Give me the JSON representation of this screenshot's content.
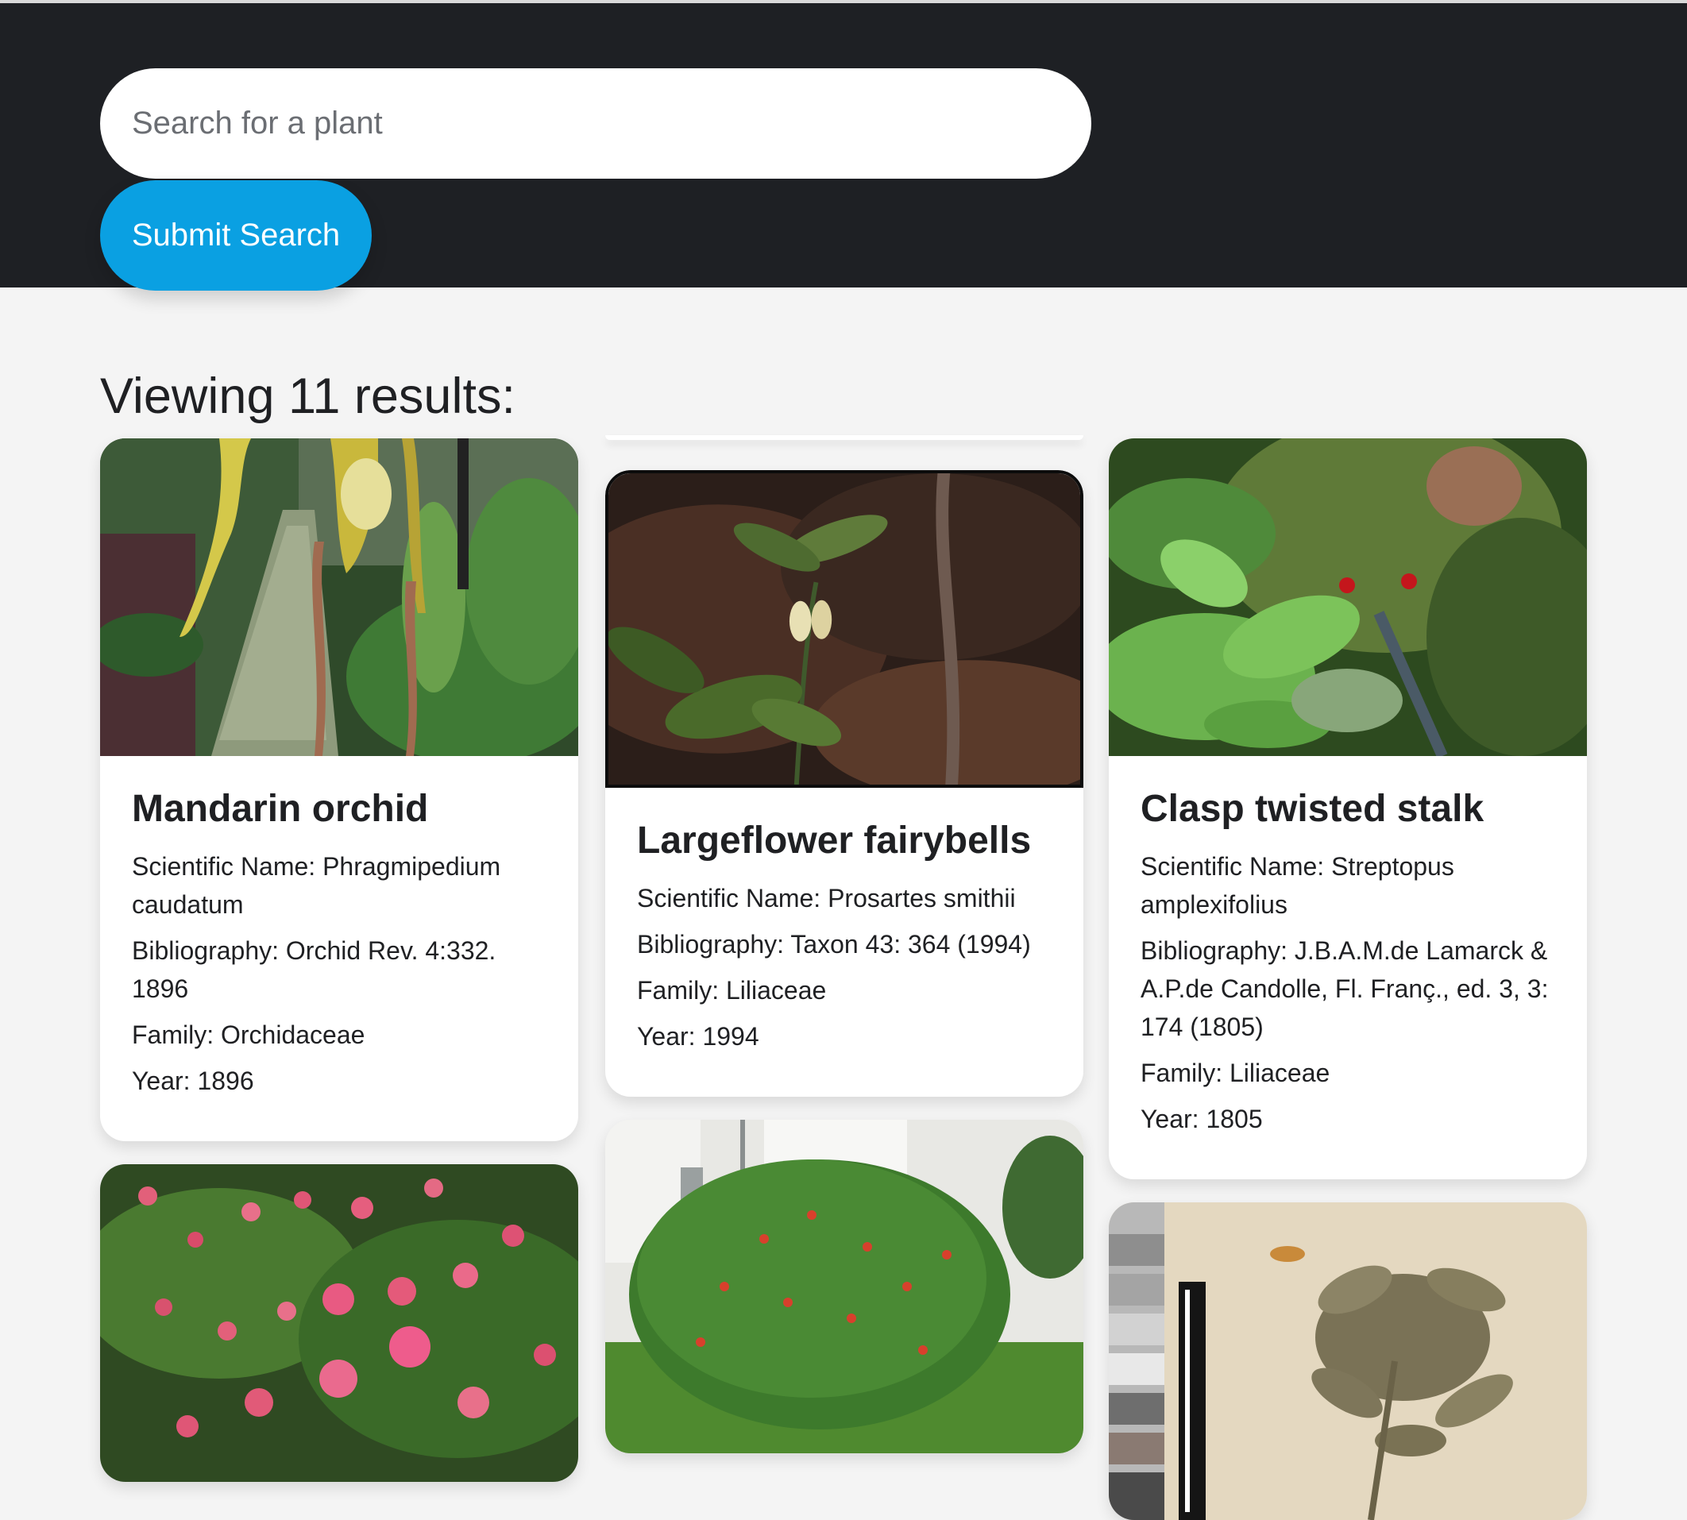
{
  "search": {
    "placeholder": "Search for a plant",
    "value": "",
    "submit_label": "Submit Search"
  },
  "results": {
    "heading": "Viewing 11 results:",
    "count": 11
  },
  "cards": [
    {
      "title": "Mandarin orchid",
      "scientific": "Scientific Name: Phragmipedium caudatum",
      "bibliography": "Bibliography: Orchid Rev. 4:332. 1896",
      "family": "Family: Orchidaceae",
      "year": "Year: 1896"
    },
    {
      "title": "Largeflower fairybells",
      "scientific": "Scientific Name: Prosartes smithii",
      "bibliography": "Bibliography: Taxon 43: 364 (1994)",
      "family": "Family: Liliaceae",
      "year": "Year: 1994"
    },
    {
      "title": "Clasp twisted stalk",
      "scientific": "Scientific Name: Streptopus amplexifolius",
      "bibliography": "Bibliography: J.B.A.M.de Lamarck & A.P.de Candolle, Fl. Franç., ed. 3, 3: 174 (1805)",
      "family": "Family: Liliaceae",
      "year": "Year: 1805"
    }
  ],
  "colors": {
    "header_bg": "#1e2024",
    "accent": "#0aa0e2",
    "page_bg": "#f4f4f4",
    "card_bg": "#ffffff",
    "text": "#1f2023"
  }
}
